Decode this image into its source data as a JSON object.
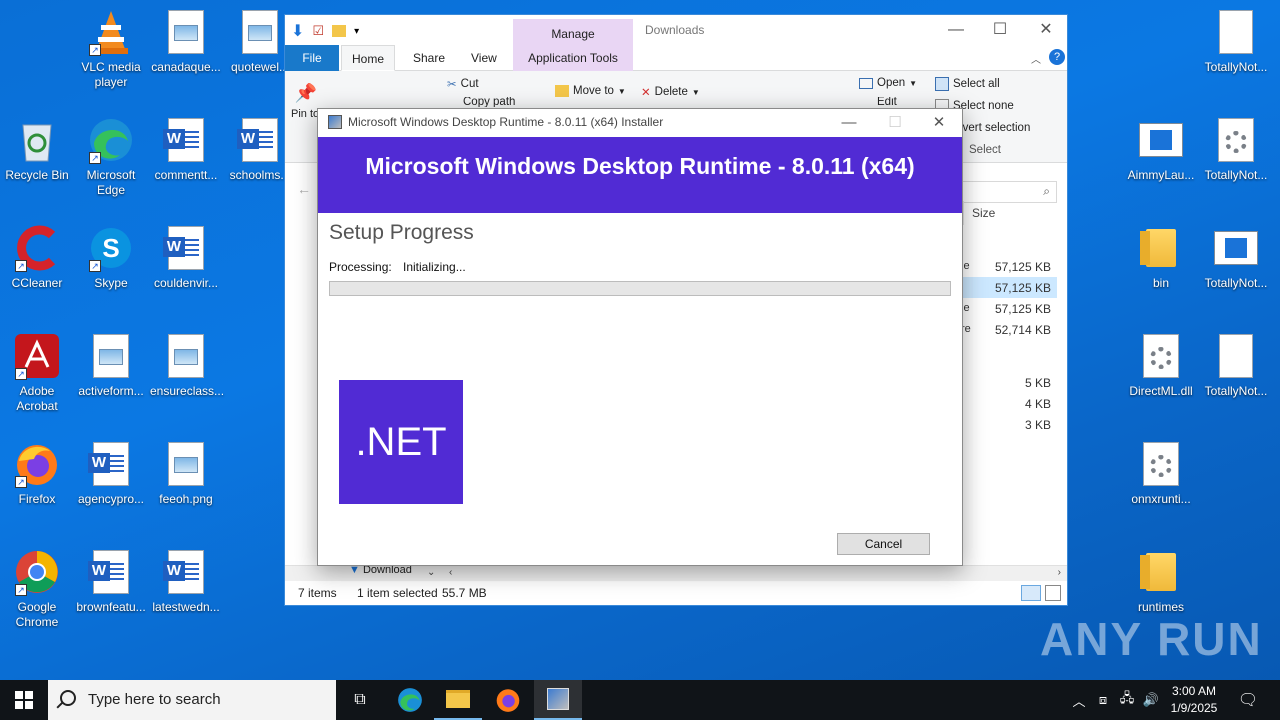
{
  "desktop": {
    "icons": [
      {
        "label": "VLC media player",
        "kind": "vlc"
      },
      {
        "label": "canadaque...",
        "kind": "image"
      },
      {
        "label": "quotewel...",
        "kind": "image"
      },
      {
        "label": "Recycle Bin",
        "kind": "recycle"
      },
      {
        "label": "Microsoft Edge",
        "kind": "edge"
      },
      {
        "label": "commentt...",
        "kind": "word"
      },
      {
        "label": "schoolms...",
        "kind": "word"
      },
      {
        "label": "CCleaner",
        "kind": "ccleaner"
      },
      {
        "label": "Skype",
        "kind": "skype"
      },
      {
        "label": "couldenvir...",
        "kind": "word"
      },
      {
        "label": "Adobe Acrobat",
        "kind": "acrobat"
      },
      {
        "label": "activeform...",
        "kind": "image"
      },
      {
        "label": "ensureclass...",
        "kind": "image"
      },
      {
        "label": "Firefox",
        "kind": "firefox"
      },
      {
        "label": "agencypro...",
        "kind": "word"
      },
      {
        "label": "feeoh.png",
        "kind": "image"
      },
      {
        "label": "Google Chrome",
        "kind": "chrome"
      },
      {
        "label": "brownfeatu...",
        "kind": "word"
      },
      {
        "label": "latestwedn...",
        "kind": "word"
      },
      {
        "label": "TotallyNot...",
        "kind": "blank"
      },
      {
        "label": "AimmyLau...",
        "kind": "app"
      },
      {
        "label": "TotallyNot...",
        "kind": "gear"
      },
      {
        "label": "bin",
        "kind": "folder"
      },
      {
        "label": "TotallyNot...",
        "kind": "app"
      },
      {
        "label": "DirectML.dll",
        "kind": "gear"
      },
      {
        "label": "TotallyNot...",
        "kind": "blank"
      },
      {
        "label": "onnxrunti...",
        "kind": "gear"
      },
      {
        "label": "runtimes",
        "kind": "folder"
      }
    ]
  },
  "explorer": {
    "title": "Downloads",
    "tabs": {
      "file": "File",
      "home": "Home",
      "share": "Share",
      "view": "View",
      "manage": "Manage",
      "app_tools": "Application Tools"
    },
    "ribbon": {
      "pin": "Pin to Quick access",
      "cut": "Cut",
      "copy_path": "Copy path",
      "move_to": "Move to",
      "delete": "Delete",
      "open": "Open",
      "edit": "Edit",
      "select_all": "Select all",
      "select_none": "Select none",
      "invert_selection": "Invert selection",
      "select_group": "Select"
    },
    "column_size": "Size",
    "sizes_top": [
      "57,125 KB",
      "57,125 KB",
      "57,125 KB",
      "52,714 KB"
    ],
    "type_tails": [
      "le",
      "",
      "le",
      "re"
    ],
    "sizes_bottom": [
      "5 KB",
      "4 KB",
      "3 KB"
    ],
    "nav_item": "Download",
    "status": {
      "items": "7 items",
      "selected": "1 item selected",
      "size": "55.7 MB"
    }
  },
  "installer": {
    "window_title": "Microsoft Windows Desktop Runtime - 8.0.11 (x64) Installer",
    "banner": "Microsoft Windows Desktop Runtime - 8.0.11 (x64)",
    "heading": "Setup Progress",
    "processing_label": "Processing:",
    "processing_value": "Initializing...",
    "progress": 0,
    "logo_text": ".NET",
    "cancel": "Cancel"
  },
  "watermark": "ANY RUN",
  "taskbar": {
    "search_placeholder": "Type here to search",
    "time": "3:00 AM",
    "date": "1/9/2025"
  }
}
